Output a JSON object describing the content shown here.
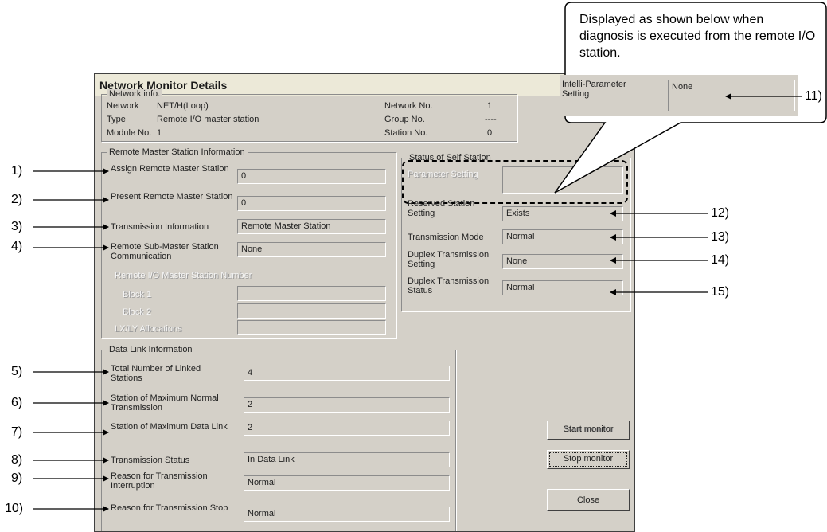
{
  "dialog": {
    "title": "Network Monitor Details"
  },
  "network_info": {
    "group_label": "Network info.",
    "network_label": "Network",
    "network_value": "NET/H(Loop)",
    "type_label": "Type",
    "type_value": "Remote I/O master station",
    "module_label": "Module No.",
    "module_value": "1",
    "netno_label": "Network No.",
    "netno_value": "1",
    "groupno_label": "Group No.",
    "groupno_value": "----",
    "stationno_label": "Station No.",
    "stationno_value": "0"
  },
  "remote_master": {
    "group_label": "Remote Master Station Information",
    "assign_label": "Assign Remote Master Station",
    "assign_value": "0",
    "present_label": "Present Remote Master Station",
    "present_value": "0",
    "trans_info_label": "Transmission Information",
    "trans_info_value": "Remote Master Station",
    "submaster_label": "Remote Sub-Master Station Communication",
    "submaster_value": "None",
    "io_master_number_label": "Remote I/O Master Station Number",
    "block1_label": "Block 1",
    "block2_label": "Block 2",
    "lxly_label": "LX/LY Allocations"
  },
  "self_station": {
    "group_label": "Status of Self Station",
    "param_label": "Parameter Setting",
    "reserved_label": "Reserved Station Setting",
    "reserved_value": "Exists",
    "mode_label": "Transmission Mode",
    "mode_value": "Normal",
    "duplex_setting_label": "Duplex Transmission Setting",
    "duplex_setting_value": "None",
    "duplex_status_label": "Duplex Transmission Status",
    "duplex_status_value": "Normal"
  },
  "data_link": {
    "group_label": "Data Link Information",
    "total_label": "Total Number of Linked Stations",
    "total_value": "4",
    "max_normal_label": "Station of Maximum Normal Transmission",
    "max_normal_value": "2",
    "max_data_label": "Station of Maximum Data Link",
    "max_data_value": "2",
    "status_label": "Transmission Status",
    "status_value": "In Data Link",
    "interrupt_label": "Reason for Transmission Interruption",
    "interrupt_value": "Normal",
    "stop_label": "Reason for Transmission Stop",
    "stop_value": "Normal"
  },
  "buttons": {
    "start": "Start monitor",
    "stop": "Stop monitor",
    "close": "Close"
  },
  "callout": {
    "text": "Displayed as shown below when diagnosis is executed from the remote I/O station.",
    "intelli_label": "Intelli-Parameter Setting",
    "intelli_value": "None"
  },
  "annotations": [
    "1)",
    "2)",
    "3)",
    "4)",
    "5)",
    "6)",
    "7)",
    "8)",
    "9)",
    "10)",
    "11)",
    "12)",
    "13)",
    "14)",
    "15)"
  ]
}
